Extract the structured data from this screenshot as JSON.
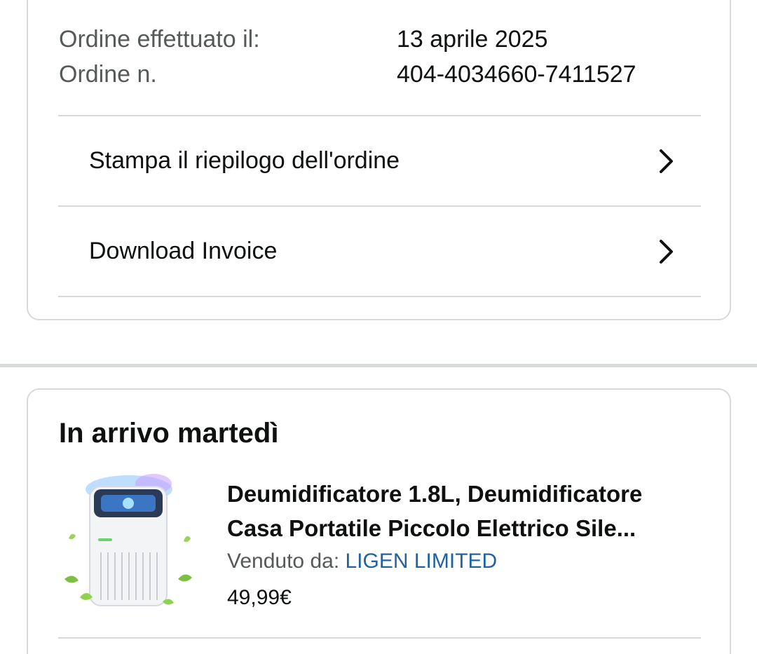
{
  "order_info": {
    "date_label": "Ordine effettuato il:",
    "date_value": "13 aprile 2025",
    "number_label": "Ordine n.",
    "number_value": "404-4034660-7411527"
  },
  "actions": {
    "print_summary": "Stampa il riepilogo dell'ordine",
    "download_invoice": "Download Invoice"
  },
  "shipment": {
    "title": "In arrivo martedì",
    "product": {
      "title_line1": "Deumidificatore 1.8L, Deumidificatore",
      "title_line2": "Casa Portatile Piccolo Elettrico Sile...",
      "seller_label": "Venduto da:",
      "seller_name": "LIGEN LIMITED",
      "price": "49,99€",
      "image_icon": "dehumidifier-product-image"
    }
  },
  "colors": {
    "border": "#d5d9d9",
    "label_gray": "#565959",
    "text": "#0f1111",
    "link_blue": "#2162a1"
  }
}
